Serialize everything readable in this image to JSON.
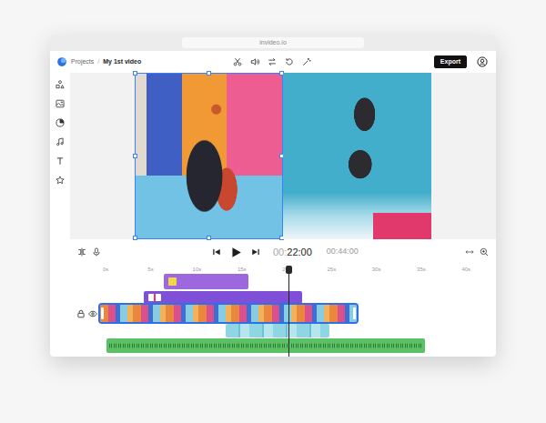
{
  "browser": {
    "url": "invideo.io"
  },
  "header": {
    "breadcrumb": [
      {
        "label": "Projects"
      },
      {
        "label": "My 1st video"
      }
    ],
    "separator": "/",
    "export": "Export"
  },
  "canvas": {
    "items": [
      {
        "selected": true
      },
      {
        "selected": false
      }
    ]
  },
  "player": {
    "current_prefix": "00:",
    "current": "22:00",
    "total": "00:44:00"
  },
  "timeline": {
    "ruler": [
      "0s",
      "5s",
      "10s",
      "15s",
      "20s",
      "25s",
      "30s",
      "35s",
      "40s"
    ],
    "playhead": {
      "level": 0.476
    },
    "tracks": [
      {
        "kind": "sticker",
        "selected": false
      },
      {
        "kind": "text",
        "selected": false
      },
      {
        "kind": "video",
        "selected": true
      },
      {
        "kind": "overlay",
        "selected": false
      },
      {
        "kind": "audio",
        "selected": false
      }
    ]
  }
}
